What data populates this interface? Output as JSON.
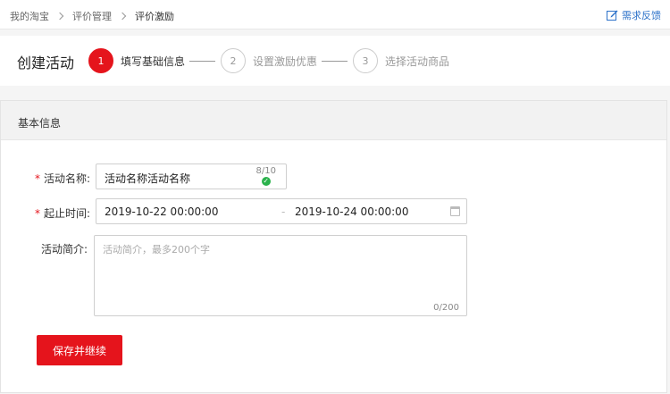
{
  "breadcrumb": {
    "items": [
      "我的淘宝",
      "评价管理",
      "评价激励"
    ]
  },
  "header": {
    "feedback_label": "需求反馈",
    "feedback_icon": "edit-icon"
  },
  "steps": {
    "page_title": "创建活动",
    "items": [
      {
        "number": "1",
        "label": "填写基础信息",
        "state": "active"
      },
      {
        "number": "2",
        "label": "设置激励优惠",
        "state": "pending"
      },
      {
        "number": "3",
        "label": "选择活动商品",
        "state": "pending"
      }
    ]
  },
  "section": {
    "title": "基本信息"
  },
  "form": {
    "required_mark": "*",
    "name": {
      "label": "活动名称:",
      "value": "活动名称活动名称",
      "count": "8/10",
      "valid_icon": "check-circle-icon"
    },
    "time": {
      "label": "起止时间:",
      "start": "2019-10-22 00:00:00",
      "separator": "-",
      "end": "2019-10-24 00:00:00",
      "icon": "calendar-icon"
    },
    "desc": {
      "label": "活动简介:",
      "placeholder": "活动简介，最多200个字",
      "count": "0/200"
    },
    "submit_label": "保存并继续"
  },
  "colors": {
    "accent": "#e5141c",
    "link": "#2d72c9",
    "success": "#2bb24c"
  }
}
